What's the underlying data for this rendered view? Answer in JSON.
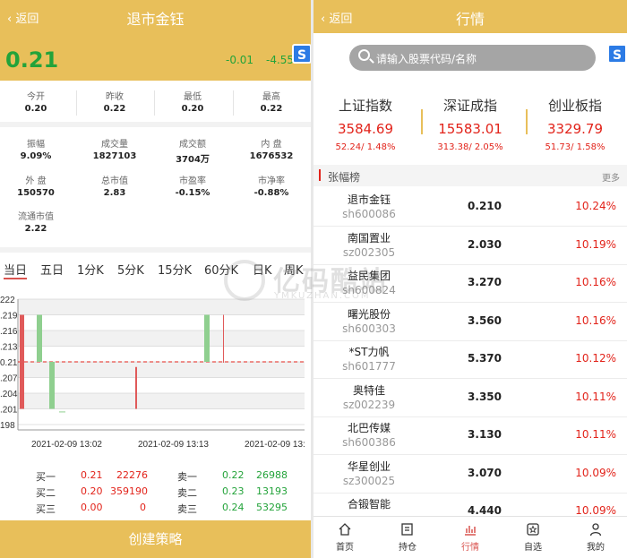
{
  "left": {
    "header": {
      "back": "返回",
      "title": "退市金钰"
    },
    "quote": {
      "price": "0.21",
      "change": "-0.01",
      "change_pct": "-4.55"
    },
    "stats_row1": [
      {
        "label": "今开",
        "value": "0.20"
      },
      {
        "label": "昨收",
        "value": "0.22"
      },
      {
        "label": "最低",
        "value": "0.20"
      },
      {
        "label": "最高",
        "value": "0.22"
      }
    ],
    "stats_grid": [
      {
        "label": "振幅",
        "value": "9.09%"
      },
      {
        "label": "成交量",
        "value": "1827103"
      },
      {
        "label": "成交额",
        "value": "3704万"
      },
      {
        "label": "内 盘",
        "value": "1676532"
      },
      {
        "label": "外 盘",
        "value": "150570"
      },
      {
        "label": "总市值",
        "value": "2.83"
      },
      {
        "label": "市盈率",
        "value": "-0.15%"
      },
      {
        "label": "市净率",
        "value": "-0.88%"
      },
      {
        "label": "流通市值",
        "value": "2.22"
      }
    ],
    "tabs": [
      "当日",
      "五日",
      "1分K",
      "5分K",
      "15分K",
      "60分K",
      "日K",
      "周K"
    ],
    "order_book": [
      {
        "buy_label": "买一",
        "buy_price": "0.21",
        "buy_vol": "22276",
        "sell_label": "卖一",
        "sell_price": "0.22",
        "sell_vol": "26988"
      },
      {
        "buy_label": "买二",
        "buy_price": "0.20",
        "buy_vol": "359190",
        "sell_label": "卖二",
        "sell_price": "0.23",
        "sell_vol": "13193"
      },
      {
        "buy_label": "买三",
        "buy_price": "0.00",
        "buy_vol": "0",
        "sell_label": "卖三",
        "sell_price": "0.24",
        "sell_vol": "53295"
      }
    ],
    "footer_button": "创建策略"
  },
  "watermark": {
    "text": "亿码酷站",
    "sub": "YMKUZHAN.COM"
  },
  "chart_data": {
    "type": "candlestick",
    "y_ticks": [
      "222",
      ".219",
      ".216",
      ".213",
      "0.21",
      ".207",
      ".204",
      ".201",
      "198"
    ],
    "ylim": [
      0.198,
      0.222
    ],
    "x_labels": [
      "2021-02-09 13:02",
      "2021-02-09 13:13",
      "2021-02-09 13:"
    ],
    "reference_line": 0.21,
    "candles": [
      {
        "open": 0.201,
        "close": 0.219,
        "high": 0.219,
        "low": 0.201,
        "color": "red"
      },
      {
        "open": 0.219,
        "close": 0.21,
        "high": 0.219,
        "low": 0.21,
        "color": "green"
      },
      {
        "open": 0.21,
        "close": 0.201,
        "high": 0.21,
        "low": 0.201,
        "color": "green"
      },
      {
        "open": 0.2005,
        "close": 0.2005,
        "high": 0.2005,
        "low": 0.2005,
        "color": "green"
      },
      {
        "open": 0.201,
        "close": 0.209,
        "high": 0.209,
        "low": 0.201,
        "color": "red"
      },
      {
        "open": 0.209,
        "close": 0.209,
        "high": 0.209,
        "low": 0.201,
        "color": "red"
      },
      {
        "open": 0.219,
        "close": 0.21,
        "high": 0.219,
        "low": 0.21,
        "color": "green"
      },
      {
        "open": 0.21,
        "close": 0.21,
        "high": 0.219,
        "low": 0.21,
        "color": "red"
      }
    ]
  },
  "right": {
    "header": {
      "back": "返回",
      "title": "行情"
    },
    "search_placeholder": "请输入股票代码/名称",
    "indices": [
      {
        "name": "上证指数",
        "value": "3584.69",
        "change": "52.24/ 1.48%"
      },
      {
        "name": "深证成指",
        "value": "15583.01",
        "change": "313.38/ 2.05%"
      },
      {
        "name": "创业板指",
        "value": "3329.79",
        "change": "51.73/ 1.58%"
      }
    ],
    "section_title": "张幅榜",
    "section_more": "更多",
    "stocks": [
      {
        "name": "退市金钰",
        "code": "sh600086",
        "price": "0.210",
        "pct": "10.24%"
      },
      {
        "name": "南国置业",
        "code": "sz002305",
        "price": "2.030",
        "pct": "10.19%"
      },
      {
        "name": "益民集团",
        "code": "sh600824",
        "price": "3.270",
        "pct": "10.16%"
      },
      {
        "name": "曙光股份",
        "code": "sh600303",
        "price": "3.560",
        "pct": "10.16%"
      },
      {
        "name": "*ST力帆",
        "code": "sh601777",
        "price": "5.370",
        "pct": "10.12%"
      },
      {
        "name": "奥特佳",
        "code": "sz002239",
        "price": "3.350",
        "pct": "10.11%"
      },
      {
        "name": "北巴传媒",
        "code": "sh600386",
        "price": "3.130",
        "pct": "10.11%"
      },
      {
        "name": "华星创业",
        "code": "sz300025",
        "price": "3.070",
        "pct": "10.09%"
      },
      {
        "name": "合锻智能",
        "code": "",
        "price": "4.440",
        "pct": "10.09%"
      }
    ],
    "nav": [
      {
        "label": "首页",
        "icon": "home-icon"
      },
      {
        "label": "持仓",
        "icon": "portfolio-icon"
      },
      {
        "label": "行情",
        "icon": "market-icon",
        "active": true
      },
      {
        "label": "自选",
        "icon": "favorites-icon"
      },
      {
        "label": "我的",
        "icon": "user-icon"
      }
    ]
  },
  "colors": {
    "header": "#e8bf5a",
    "up": "#e2231a",
    "down": "#23a33a",
    "side_button": "#2c7be5"
  }
}
